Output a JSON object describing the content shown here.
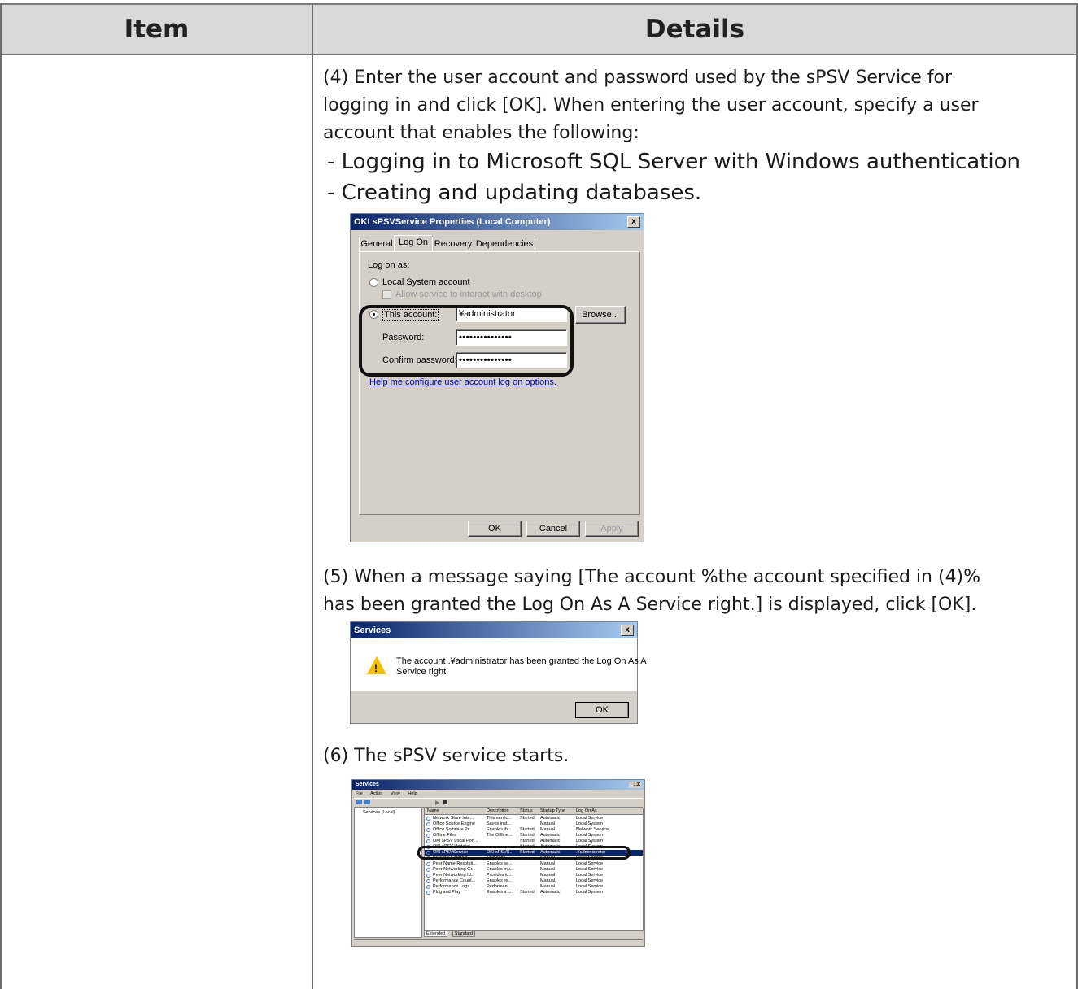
{
  "table": {
    "header_item": "Item",
    "header_details": "Details"
  },
  "step4": {
    "line1": "(4) Enter the user account and password used by the sPSV Service for",
    "line2": "logging in and click [OK]. When entering the user account, specify a user",
    "line3": "account that enables the following:",
    "bullet1": "- Logging in to Microsoft SQL Server with Windows authentication",
    "bullet2": "- Creating and updating databases."
  },
  "props_dialog": {
    "title": "OKI sPSVService Properties (Local Computer)",
    "tabs": [
      "General",
      "Log On",
      "Recovery",
      "Dependencies"
    ],
    "log_on_as": "Log on as:",
    "local_system": "Local System account",
    "allow_interact": "Allow service to interact with desktop",
    "this_account": "This account:",
    "account_value": "¥administrator",
    "browse": "Browse...",
    "password_label": "Password:",
    "password_value": "•••••••••••••••",
    "confirm_label": "Confirm password:",
    "confirm_value": "•••••••••••••••",
    "help_link": "Help me configure user account log on options.",
    "ok": "OK",
    "cancel": "Cancel",
    "apply": "Apply",
    "close_glyph": "x"
  },
  "step5": {
    "line1": "(5) When a message saying [The account %the account specified in (4)%",
    "line2": "has been granted the Log On As A Service right.] is displayed, click [OK]."
  },
  "services_msg": {
    "title": "Services",
    "message_line1": "The account .¥administrator has been granted the Log On As A",
    "message_line2": "Service right.",
    "ok": "OK",
    "close_glyph": "x",
    "warning_glyph": "!"
  },
  "step6": {
    "line1": "(6) The sPSV service starts."
  },
  "services_window": {
    "title": "Services",
    "menu": [
      "File",
      "Action",
      "View",
      "Help"
    ],
    "tree_item": "Services (Local)",
    "columns": [
      "Name",
      "Description",
      "Status",
      "Startup Type",
      "Log On As"
    ],
    "rows": [
      [
        "Network Store Inte...",
        "This servic...",
        "Started",
        "Automatic",
        "Local Service"
      ],
      [
        "Office Source Engine",
        "Saves inst...",
        "",
        "Manual",
        "Local System"
      ],
      [
        "Office Software Pr...",
        "Enables th...",
        "Started",
        "Manual",
        "Network Service"
      ],
      [
        "Offline Files",
        "The Offline...",
        "Started",
        "Automatic",
        "Local System"
      ],
      [
        "OKI sPSV Local Port...",
        "",
        "Started",
        "Automatic",
        "Local System"
      ],
      [
        "OKI sPSV Updater",
        "",
        "Started",
        "Automatic",
        "Local System"
      ],
      [
        "OKI sPSVService",
        "OKI sPSVS...",
        "Started",
        "Automatic",
        ".¥administrator"
      ],
      [
        "Parental Controls",
        "This servi...",
        "",
        "Manual",
        "Local Service"
      ],
      [
        "Peer Name Resoluti...",
        "Enables se...",
        "",
        "Manual",
        "Local Service"
      ],
      [
        "Peer Networking Gr...",
        "Enables mu...",
        "",
        "Manual",
        "Local Service"
      ],
      [
        "Peer Networking Id...",
        "Provides id...",
        "",
        "Manual",
        "Local Service"
      ],
      [
        "Performance Count...",
        "Enables re...",
        "",
        "Manual",
        "Local Service"
      ],
      [
        "Performance Logs ...",
        "Performan...",
        "",
        "Manual",
        "Local Service"
      ],
      [
        "Plug and Play",
        "Enables a c...",
        "Started",
        "Automatic",
        "Local System"
      ]
    ],
    "selected_index": 6,
    "bottom_tabs": [
      "Extended",
      "Standard"
    ],
    "window_controls": "_□x"
  }
}
